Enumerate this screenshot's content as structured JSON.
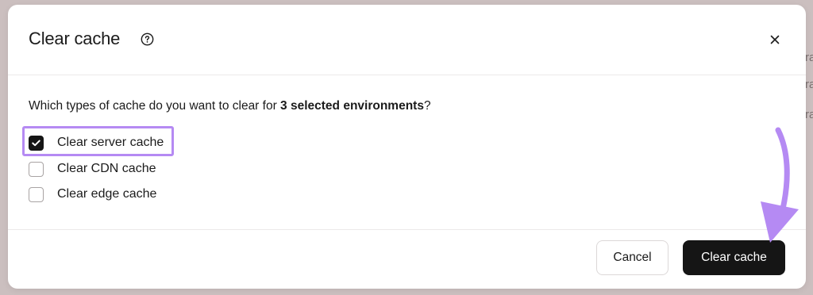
{
  "backdrop": {
    "fragments": [
      "ra",
      "ra",
      "ra"
    ]
  },
  "dialog": {
    "title": "Clear cache",
    "help_icon": "question-circle-icon",
    "close_icon": "close-icon",
    "close_glyph": "×",
    "question_prefix": "Which types of cache do you want to clear for ",
    "question_bold": "3 selected environments",
    "question_suffix": "?",
    "options": [
      {
        "label": "Clear server cache",
        "checked": true
      },
      {
        "label": "Clear CDN cache",
        "checked": false
      },
      {
        "label": "Clear edge cache",
        "checked": false
      }
    ],
    "cancel_label": "Cancel",
    "confirm_label": "Clear cache"
  },
  "annotation": {
    "highlight_color": "#b58af3",
    "arrow_color": "#b58af3"
  },
  "colors": {
    "primary_button": "#151515",
    "backdrop": "#cbbfbf"
  }
}
